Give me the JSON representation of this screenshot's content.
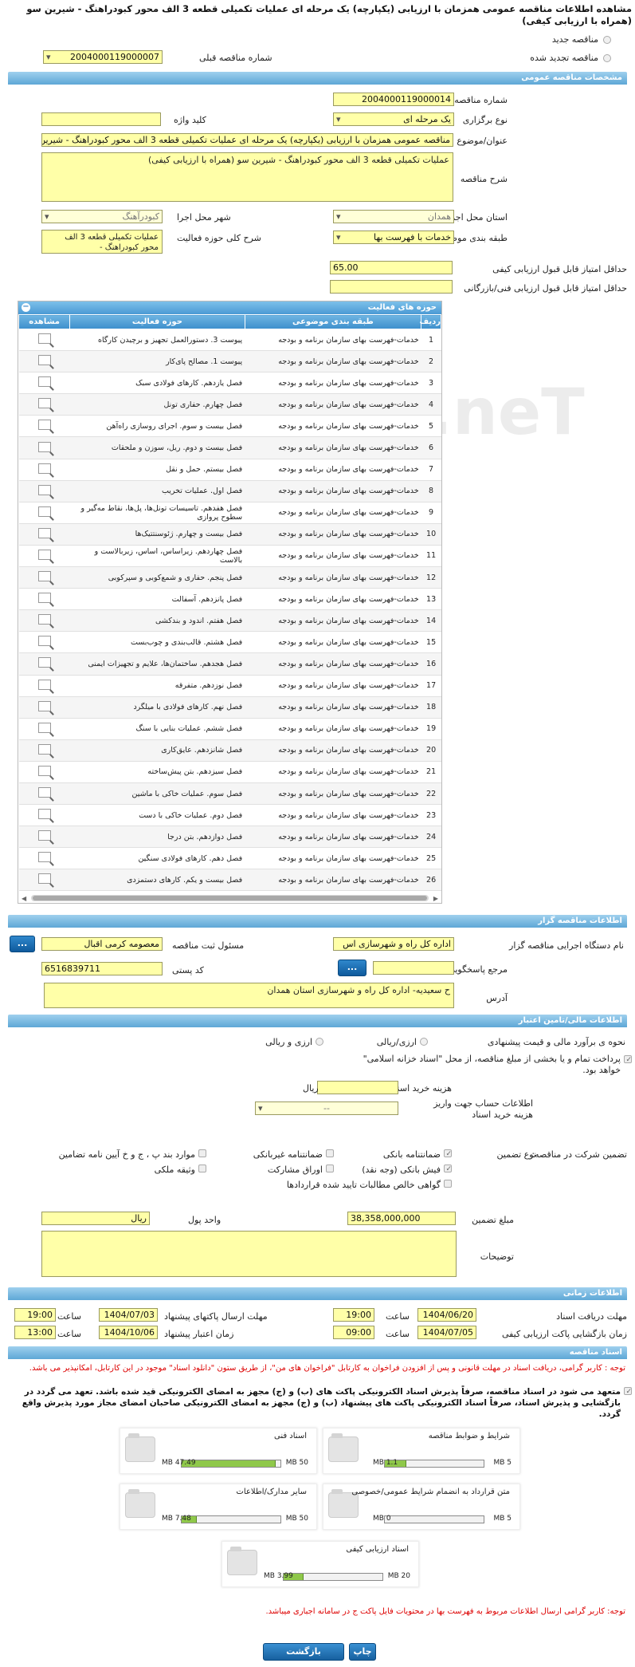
{
  "page_title": "مشاهده اطلاعات مناقصه عمومی همزمان با ارزیابی (یکپارچه) یک مرحله ای عملیات تکمیلی قطعه 3 الف محور کبودراهنگ - شیرین سو (همراه با ارزیابی کیفی)",
  "top": {
    "new_tender": "مناقصه جدید",
    "renewal": "مناقصه تجدید شده",
    "prev_number_label": "شماره مناقصه قبلی",
    "prev_number": "2004000119000007"
  },
  "general": {
    "header": "مشخصات مناقصه عمومی",
    "number_label": "شماره مناقصه",
    "number": "2004000119000014",
    "type_label": "نوع برگزاری",
    "type": "یک مرحله ای",
    "keyword_label": "کلید واژه",
    "keyword": "",
    "subject_label": "عنوان/موضوع مناقصه",
    "subject": "مناقصه عمومی همزمان با ارزیابی (یکپارچه) یک مرحله ای عملیات تکمیلی قطعه 3 الف محور کبودراهنگ - شیرین سو",
    "desc_label": "شرح مناقصه",
    "desc": "عملیات تکمیلی قطعه 3 الف محور کبودراهنگ - شیرین سو (همراه با ارزیابی کیفی)",
    "province_label": "استان محل اجرا",
    "province": "همدان",
    "city_label": "شهر محل اجرا",
    "city": "کبودرآهنگ",
    "category_label": "طبقه بندی موضوعی",
    "category": "خدمات با فهرست بها",
    "scope_label": "شرح کلی حوزه فعالیت",
    "scope": "عملیات تکمیلی قطعه 3 الف محور کبودراهنگ -",
    "quality_min_label": "حداقل امتیاز قابل قبول ارزیابی کیفی",
    "quality_min": "65.00",
    "tech_min_label": "حداقل امتیاز قابل قبول ارزیابی فنی/بازرگانی",
    "tech_min": ""
  },
  "activity": {
    "header": "حوزه های فعالیت",
    "col_row": "ردیف",
    "col_cat": "طبقه بندی موضوعی",
    "col_area": "حوزه فعالیت",
    "col_view": "مشاهده",
    "cat_text": "خدمات-فهرست بهای سازمان برنامه و بودجه",
    "rows": [
      "پیوست 3. دستورالعمل تجهیز و برچیدن کارگاه",
      "پیوست 1. مصالح پای‌کار",
      "فصل یازدهم. کارهای فولادی سبک",
      "فصل چهارم. حفاری تونل",
      "فصل بیست و سوم. اجرای روسازی راه‌آهن",
      "فصل بیست و دوم. ریل، سوزن و ملحقات",
      "فصل بیستم. حمل و نقل",
      "فصل اول. عملیات تخریب",
      "فصل هفدهم. تاسیسات تونل‌ها، پل‌ها، نقاط مه‌گیر و سطوح پروازی",
      "فصل بیست و چهارم. ژئوسنتتیک‌ها",
      "فصل چهاردهم. زیراساس، اساس، زیربالاست و بالاست",
      "فصل پنجم. حفاری و شمع‌کوبی و سپرکوبی",
      "فصل پانزدهم. آسفالت",
      "فصل هفتم. اندود و بندکشی",
      "فصل هشتم. قالب‌بندی و چوب‌بست",
      "فصل هجدهم. ساختمان‌ها، علایم و تجهیزات ایمنی",
      "فصل نوزدهم. متفرقه",
      "فصل نهم. کارهای فولادی با میلگرد",
      "فصل ششم. عملیات بنایی با سنگ",
      "فصل شانزدهم. عایق‌کاری",
      "فصل سیزدهم. بتن پیش‌ساخته",
      "فصل سوم. عملیات خاکی با ماشین",
      "فصل دوم. عملیات خاکی با دست",
      "فصل دوازدهم. بتن درجا",
      "فصل دهم. کارهای فولادی سنگین",
      "فصل بیست و یکم. کارهای دستمزدی"
    ]
  },
  "organizer": {
    "header": "اطلاعات مناقصه گزار",
    "org_label": "نام دستگاه اجرایی مناقصه گزار",
    "org": "اداره کل راه و شهرسازی اس",
    "officer_label": "مسئول ثبت مناقصه",
    "officer": "معصومه کرمی اقبال",
    "ref_label": "مرجع پاسخگویی",
    "ref": "",
    "postal_label": "کد پستی",
    "postal": "6516839711",
    "address_label": "آدرس",
    "address": "ح سعیدیه- اداره کل راه و شهرسازی استان همدان",
    "btn": "..."
  },
  "financial": {
    "header": "اطلاعات مالی/تامین اعتبار",
    "estimate_label": "نحوه ی برآورد مالی و قیمت پیشنهادی",
    "opt1": "ارزی/ریالی",
    "opt2": "ارزی و ریالی",
    "treasury": "پرداخت تمام و یا بخشی از مبلغ مناقصه، از محل \"اسناد خزانه اسلامی\" خواهد بود.",
    "doc_cost_label": "هزینه خرید اسناد",
    "doc_cost_unit": "ریال",
    "account_label": "اطلاعات حساب جهت واریز هزینه خرید اسناد",
    "account": "--",
    "guarantee_label": "نوع تضمین",
    "guarantee_title": "تضمین شرکت در مناقصه:",
    "g1": "ضمانتنامه بانکی",
    "g2": "ضمانتنامه غیربانکی",
    "g3": "موارد بند پ ، ج و خ آیین نامه تضامین",
    "g4": "فیش بانکی (وجه نقد)",
    "g5": "اوراق مشارکت",
    "g6": "وثیقه ملکی",
    "g7": "گواهی خالص مطالبات تایید شده قراردادها",
    "amount_label": "مبلغ تضمین",
    "amount": "38,358,000,000",
    "unit_label": "واحد پول",
    "unit": "ریال",
    "notes_label": "توضیحات"
  },
  "timing": {
    "header": "اطلاعات زمانی",
    "recv_label": "مهلت دریافت اسناد",
    "recv_date": "1404/06/20",
    "recv_time": "19:00",
    "send_label": "مهلت ارسال پاکتهای پیشنهاد",
    "send_date": "1404/07/03",
    "send_time": "19:00",
    "open_label": "زمان بازگشایی پاکت ارزیابی کیفی",
    "open_date": "1404/07/05",
    "open_time": "09:00",
    "valid_label": "زمان اعتبار پیشنهاد",
    "valid_date": "1404/10/06",
    "valid_time": "13:00",
    "time_label": "ساعت"
  },
  "docs": {
    "header": "اسناد مناقصه",
    "note1": "توجه : کاربر گرامی، دریافت اسناد در مهلت قانونی و پس از افزودن فراخوان به کارتابل \"فراخوان های من\"، از طریق ستون \"دانلود اسناد\" موجود در این کارتابل، امکانپذیر می باشد.",
    "commit": "متعهد می شود در اسناد مناقصه، صرفاً پذیرش اسناد الکترونیکی پاکت های (ب) و (ج) مجهز به امضای الکترونیکی قید شده باشد. تعهد می گردد در بازگشایی و پذیرش اسناد، صرفاً اسناد الکترونیکی پاکت های پیشنهاد (ب) و (ج) مجهز به امضای الکترونیکی صاحبان امضای مجاز مورد پذیرش واقع گردد.",
    "files": [
      {
        "name": "شرایط و ضوابط مناقصه",
        "size": "1.1 MB",
        "max": "5 MB",
        "fill": 0.22
      },
      {
        "name": "اسناد فنی",
        "size": "47.49 MB",
        "max": "50 MB",
        "fill": 0.95
      },
      {
        "name": "متن قرارداد به انضمام شرایط عمومی/خصوصی",
        "size": "0 MB",
        "max": "5 MB",
        "fill": 0
      },
      {
        "name": "سایر مدارک/اطلاعات",
        "size": "7.48 MB",
        "max": "50 MB",
        "fill": 0.15
      },
      {
        "name": "اسناد ارزیابی کیفی",
        "size": "3.99 MB",
        "max": "20 MB",
        "fill": 0.2
      }
    ],
    "note2": "توجه: کاربر گرامی ارسال اطلاعات مربوط به فهرست بها در محتویات فایل پاکت ج در سامانه اجباری میباشد."
  },
  "buttons": {
    "print": "چاپ",
    "back": "بازگشت"
  }
}
